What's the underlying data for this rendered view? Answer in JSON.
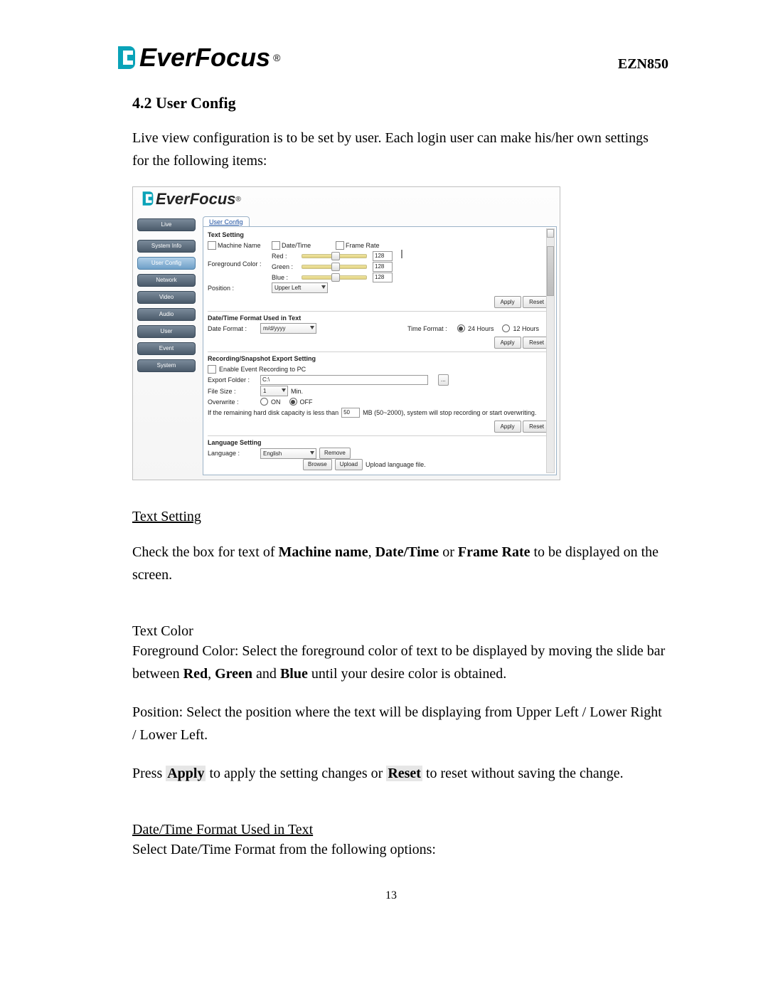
{
  "header": {
    "brand": "EverFocus",
    "reg": "®",
    "model": "EZN850"
  },
  "section_title": "4.2 User Config",
  "intro": "Live view configuration is to be set by user. Each login user can make his/her own settings for the following items:",
  "shot": {
    "brand": "EverFocus",
    "reg": "®",
    "nav": {
      "live": "Live",
      "system_info": "System Info",
      "user_config": "User Config",
      "network": "Network",
      "video": "Video",
      "audio": "Audio",
      "user": "User",
      "event": "Event",
      "system": "System"
    },
    "tab": "User Config",
    "text_setting": {
      "title": "Text Setting",
      "machine_name": "Machine Name",
      "date_time": "Date/Time",
      "frame_rate": "Frame Rate",
      "fg_label": "Foreground Color :",
      "red": "Red :",
      "green": "Green :",
      "blue": "Blue :",
      "rv": "128",
      "gv": "128",
      "bv": "128",
      "pos_label": "Position :",
      "pos_value": "Upper Left"
    },
    "dt": {
      "title": "Date/Time Format Used in Text",
      "df_label": "Date Format :",
      "df_value": "m/d/yyyy",
      "tf_label": "Time Format :",
      "tf24": "24 Hours",
      "tf12": "12 Hours"
    },
    "rec": {
      "title": "Recording/Snapshot Export Setting",
      "enable": "Enable Event Recording to PC",
      "ef_label": "Export Folder :",
      "ef_value": "C:\\",
      "fs_label": "File Size :",
      "fs_value": "1",
      "fs_unit": "Min.",
      "ow_label": "Overwrite :",
      "on": "ON",
      "off": "OFF",
      "cap_a": "If the remaining hard disk capacity is less than",
      "cap_v": "50",
      "cap_b": "MB (50~2000), system will stop recording or start overwriting."
    },
    "lang": {
      "title": "Language Setting",
      "label": "Language :",
      "value": "English",
      "remove": "Remove",
      "browse": "Browse",
      "upload": "Upload",
      "hint": "Upload language file."
    },
    "apply": "Apply",
    "reset": "Reset",
    "browse_icon": "..."
  },
  "body": {
    "h_text_setting": "Text Setting",
    "p1a": "Check the box for text of ",
    "p1b": "Machine name",
    "p1c": ", ",
    "p1d": "Date/Time",
    "p1e": " or ",
    "p1f": "Frame Rate",
    "p1g": " to be displayed on the screen.",
    "h_text_color": "Text Color",
    "p2a": "Foreground Color: Select the foreground color of text to be displayed by moving the slide bar between ",
    "p2b": "Red",
    "p2c": ", ",
    "p2d": "Green",
    "p2e": " and ",
    "p2f": "Blue",
    "p2g": " until your desire color is obtained.",
    "p3": "Position: Select the position where the text will be displaying from Upper Left / Lower Right / Lower Left.",
    "p4a": "Press ",
    "p4b": "Apply",
    "p4c": " to apply the setting changes or ",
    "p4d": "Reset",
    "p4e": " to reset without saving the change.",
    "h_dt": "Date/Time Format Used in Text",
    "p5": "Select Date/Time Format from the following options:"
  },
  "page_number": "13"
}
